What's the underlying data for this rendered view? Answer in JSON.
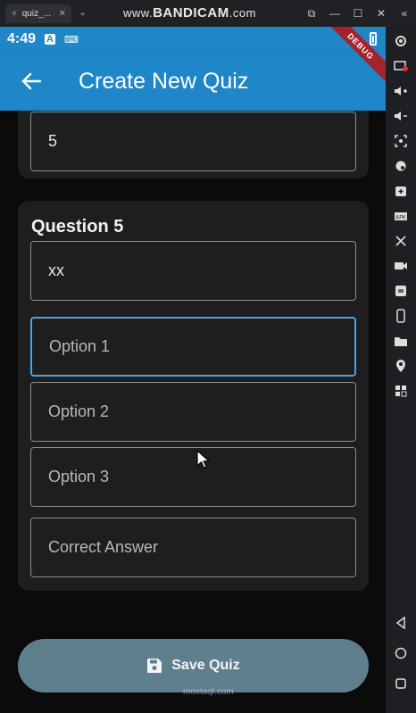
{
  "emulator": {
    "tab_label": "quiz_...",
    "tab_close": "✕",
    "tab_menu": "⌄",
    "watermark": "BANDICAM",
    "watermark_prefix": "www.",
    "watermark_suffix": ".com",
    "controls": [
      "⧉",
      "—",
      "☐",
      "✕",
      "«"
    ]
  },
  "status_bar": {
    "time": "4:49",
    "debug_label": "DEBUG"
  },
  "appbar": {
    "title": "Create New Quiz"
  },
  "previous_card": {
    "field_value": "5"
  },
  "question_card": {
    "title": "Question 5",
    "question_value": "xx",
    "option1_placeholder": "Option 1",
    "option2_placeholder": "Option 2",
    "option3_placeholder": "Option 3",
    "correct_placeholder": "Correct Answer"
  },
  "save_button": {
    "label": "Save Quiz"
  },
  "bottom_watermark": "mostaql.com",
  "colors": {
    "primary": "#1f86c8",
    "card_bg": "#1e1e1e",
    "focus_border": "#4aa3e6",
    "save_button_bg": "#5f7f8d",
    "debug_ribbon": "#a5222f"
  }
}
